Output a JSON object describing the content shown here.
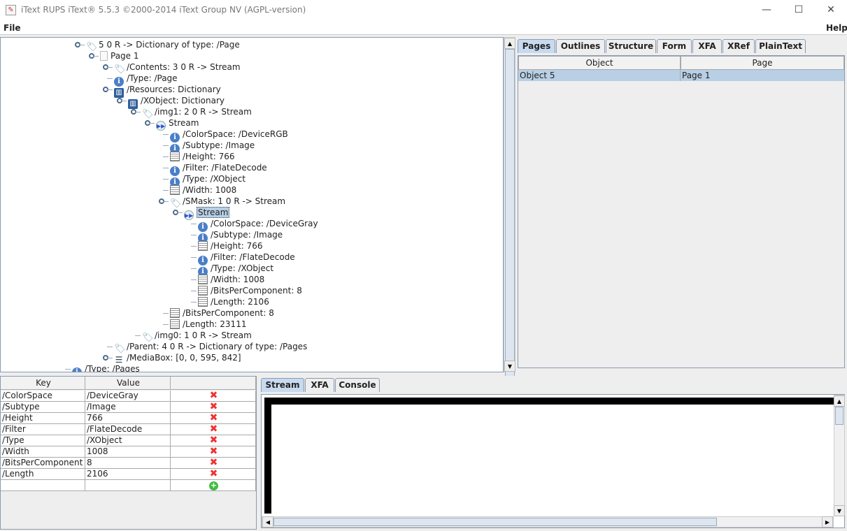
{
  "window": {
    "title": "iText RUPS iText® 5.5.3 ©2000-2014 iText Group NV (AGPL-version)",
    "minimize": "—",
    "maximize": "☐",
    "close": "✕"
  },
  "menu": {
    "file": "File",
    "help": "Help"
  },
  "tree": [
    {
      "level": 0,
      "icon": "tag",
      "label": "5 0 R -> Dictionary of type: /Page",
      "h": true
    },
    {
      "level": 1,
      "icon": "page",
      "label": "Page 1",
      "h": true
    },
    {
      "level": 2,
      "icon": "tag",
      "label": "/Contents: 3 0 R -> Stream",
      "h": true
    },
    {
      "level": 2,
      "icon": "info",
      "label": "/Type: /Page"
    },
    {
      "level": 2,
      "icon": "book",
      "label": "/Resources: Dictionary",
      "h": true
    },
    {
      "level": 3,
      "icon": "book",
      "label": "/XObject: Dictionary",
      "h": true
    },
    {
      "level": 4,
      "icon": "tag",
      "label": "/img1: 2 0 R -> Stream",
      "h": true
    },
    {
      "level": 5,
      "icon": "stream",
      "label": "Stream",
      "h": true
    },
    {
      "level": 6,
      "icon": "info",
      "label": "/ColorSpace: /DeviceRGB"
    },
    {
      "level": 6,
      "icon": "info",
      "label": "/Subtype: /Image"
    },
    {
      "level": 6,
      "icon": "calc",
      "label": "/Height: 766"
    },
    {
      "level": 6,
      "icon": "info",
      "label": "/Filter: /FlateDecode"
    },
    {
      "level": 6,
      "icon": "info",
      "label": "/Type: /XObject"
    },
    {
      "level": 6,
      "icon": "calc",
      "label": "/Width: 1008"
    },
    {
      "level": 6,
      "icon": "tag",
      "label": "/SMask: 1 0 R -> Stream",
      "h": true
    },
    {
      "level": 7,
      "icon": "stream",
      "label": "Stream",
      "h": true,
      "selected": true
    },
    {
      "level": 8,
      "icon": "info",
      "label": "/ColorSpace: /DeviceGray"
    },
    {
      "level": 8,
      "icon": "info",
      "label": "/Subtype: /Image"
    },
    {
      "level": 8,
      "icon": "calc",
      "label": "/Height: 766"
    },
    {
      "level": 8,
      "icon": "info",
      "label": "/Filter: /FlateDecode"
    },
    {
      "level": 8,
      "icon": "info",
      "label": "/Type: /XObject"
    },
    {
      "level": 8,
      "icon": "calc",
      "label": "/Width: 1008"
    },
    {
      "level": 8,
      "icon": "calc",
      "label": "/BitsPerComponent: 8"
    },
    {
      "level": 8,
      "icon": "calc",
      "label": "/Length: 2106"
    },
    {
      "level": 6,
      "icon": "calc",
      "label": "/BitsPerComponent: 8"
    },
    {
      "level": 6,
      "icon": "calc",
      "label": "/Length: 23111"
    },
    {
      "level": 4,
      "icon": "tag",
      "label": "/img0: 1 0 R -> Stream"
    },
    {
      "level": 2,
      "icon": "tag",
      "label": "/Parent: 4 0 R -> Dictionary of type: /Pages"
    },
    {
      "level": 2,
      "icon": "list",
      "label": "/MediaBox: [0, 0, 595, 842]",
      "h": true
    },
    {
      "level": -1,
      "icon": "info",
      "label": "/Type: /Pages"
    }
  ],
  "right_tabs": [
    "Pages",
    "Outlines",
    "Structure",
    "Form",
    "XFA",
    "XRef",
    "PlainText"
  ],
  "pages_table": {
    "headers": [
      "Object",
      "Page"
    ],
    "rows": [
      [
        "Object 5",
        "Page 1"
      ]
    ]
  },
  "kv_table": {
    "headers": [
      "Key",
      "Value",
      ""
    ],
    "rows": [
      [
        "/ColorSpace",
        "/DeviceGray"
      ],
      [
        "/Subtype",
        "/Image"
      ],
      [
        "/Height",
        "766"
      ],
      [
        "/Filter",
        "/FlateDecode"
      ],
      [
        "/Type",
        "/XObject"
      ],
      [
        "/Width",
        "1008"
      ],
      [
        "/BitsPerComponent",
        "8"
      ],
      [
        "/Length",
        "2106"
      ]
    ],
    "delete_glyph": "✖",
    "add_glyph": "+"
  },
  "bottom_tabs": [
    "Stream",
    "XFA",
    "Console"
  ]
}
